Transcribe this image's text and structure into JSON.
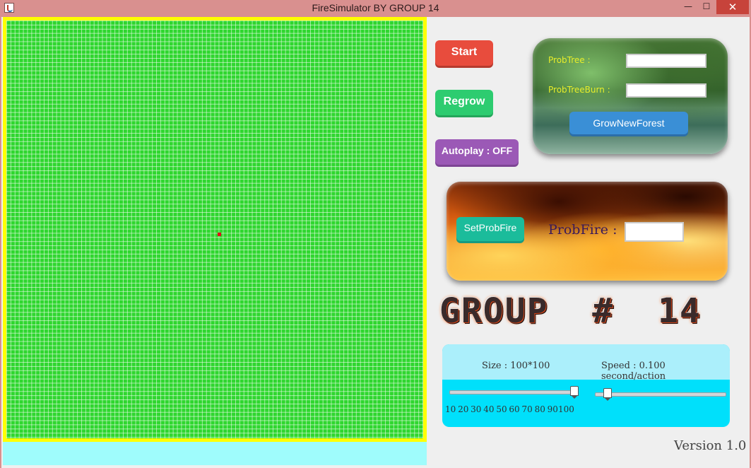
{
  "window": {
    "title": "FireSimulator BY GROUP 14",
    "minimize_glyph": "—",
    "maximize_glyph": "☐",
    "close_glyph": "✕"
  },
  "controls": {
    "start_label": "Start",
    "regrow_label": "Regrow",
    "autoplay_label": "Autoplay : OFF"
  },
  "forest": {
    "prob_tree_label": "ProbTree :",
    "prob_tree_value": "",
    "prob_tree_burn_label": "ProbTreeBurn :",
    "prob_tree_burn_value": "",
    "grow_button_label": "GrowNewForest"
  },
  "fire": {
    "set_button_label": "SetProbFire",
    "prob_fire_label": "ProbFire :",
    "prob_fire_value": ""
  },
  "logo": {
    "text": "GROUP  #  14"
  },
  "sliders": {
    "size_label": "Size : 100*100",
    "size_ticks": "10 20 30 40 50 60 70 80 90100",
    "size_value": 100,
    "speed_label": "Speed : 0.100 second/action",
    "speed_value": 0.1
  },
  "footer": {
    "version": "Version 1.0"
  },
  "colors": {
    "grid_border": "#ffff00",
    "tree_cell": "#2fd62f",
    "fire_cell": "#e0101a",
    "start_button": "#e84c3d",
    "regrow_button": "#2dcc70",
    "autoplay_button": "#9b59b6",
    "grow_button": "#3a8fd6",
    "setprobfire_button": "#1bbc9b",
    "slider_panel": "#00e0fb"
  }
}
